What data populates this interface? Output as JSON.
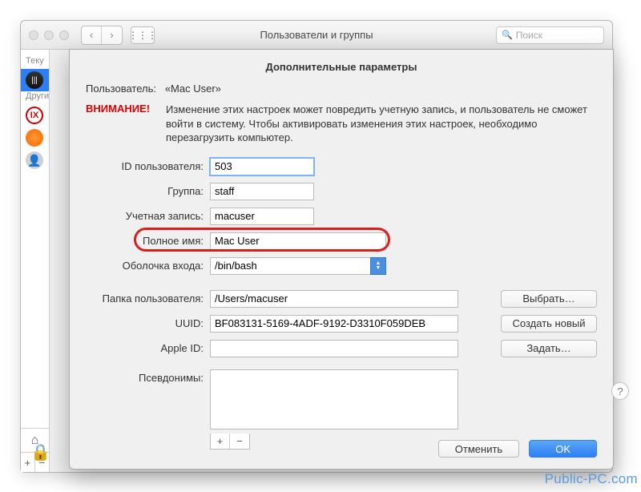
{
  "bgWindow": {
    "title": "Пользователи и группы",
    "searchPlaceholder": "Поиск",
    "sidebar": {
      "currentLabel": "Теку",
      "otherLabel": "Други"
    }
  },
  "sheet": {
    "title": "Дополнительные параметры",
    "userLabel": "Пользователь:",
    "userName": "«Mac User»",
    "warningLabel": "ВНИМАНИЕ!",
    "warningText": "Изменение этих настроек может повредить учетную запись, и пользователь не сможет войти в систему. Чтобы активировать изменения этих настроек, необходимо перезагрузить компьютер.",
    "fields": {
      "userId": {
        "label": "ID пользователя:",
        "value": "503"
      },
      "group": {
        "label": "Группа:",
        "value": "staff"
      },
      "account": {
        "label": "Учетная запись:",
        "value": "macuser"
      },
      "fullName": {
        "label": "Полное имя:",
        "value": "Mac User"
      },
      "loginShell": {
        "label": "Оболочка входа:",
        "value": "/bin/bash"
      },
      "homeDir": {
        "label": "Папка пользователя:",
        "value": "/Users/macuser",
        "button": "Выбрать…"
      },
      "uuid": {
        "label": "UUID:",
        "value": "BF083131-5169-4ADF-9192-D3310F059DEB",
        "button": "Создать новый"
      },
      "appleId": {
        "label": "Apple ID:",
        "value": "",
        "button": "Задать…"
      },
      "aliases": {
        "label": "Псевдонимы:"
      }
    },
    "buttons": {
      "cancel": "Отменить",
      "ok": "OK"
    }
  },
  "watermark": "Public-PC.com"
}
